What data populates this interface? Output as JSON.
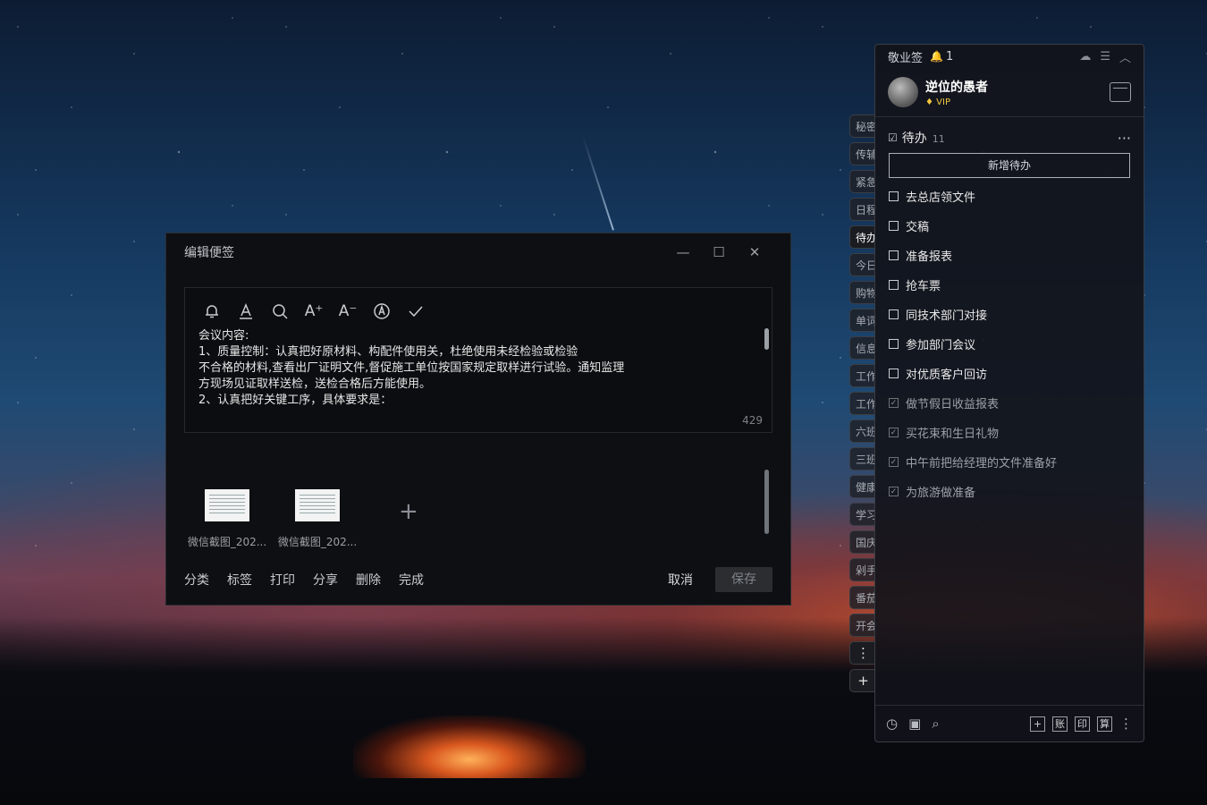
{
  "editor": {
    "title": "编辑便签",
    "win_min": "—",
    "win_max": "☐",
    "win_close": "✕",
    "toolbar": {
      "font_up": "A⁺",
      "font_down": "A⁻"
    },
    "content_lines": [
      "会议内容:",
      "1、质量控制：认真把好原材料、构配件使用关，杜绝使用未经检验或检验",
      "不合格的材料,查看出厂证明文件,督促施工单位按国家规定取样进行试验。通知监理",
      "方现场见证取样送检，送检合格后方能使用。",
      "2、认真把好关键工序，具体要求是："
    ],
    "char_count": "429",
    "attachments": [
      {
        "name": "微信截图_202..."
      },
      {
        "name": "微信截图_202..."
      }
    ],
    "add_attachment": "+",
    "actions": {
      "category": "分类",
      "tag": "标签",
      "print": "打印",
      "share": "分享",
      "delete": "删除",
      "done": "完成"
    },
    "cancel": "取消",
    "save": "保存"
  },
  "side_tabs": [
    {
      "label": "秘密"
    },
    {
      "label": "传辅"
    },
    {
      "label": "紧急"
    },
    {
      "label": "日程"
    },
    {
      "label": "待办"
    },
    {
      "label": "今日"
    },
    {
      "label": "购物"
    },
    {
      "label": "单词"
    },
    {
      "label": "信息"
    },
    {
      "label": "工作"
    },
    {
      "label": "工作"
    },
    {
      "label": "六班"
    },
    {
      "label": "三班"
    },
    {
      "label": "健康"
    },
    {
      "label": "学习"
    },
    {
      "label": "国庆"
    },
    {
      "label": "剁手"
    },
    {
      "label": "番茄"
    },
    {
      "label": "开会"
    }
  ],
  "side_more": "⋮",
  "side_add": "+",
  "panel": {
    "app_name": "敬业签",
    "reminder_count": "1",
    "user": {
      "name": "逆位的愚者",
      "badge": "VIP"
    },
    "list": {
      "title": "待办",
      "count": "11",
      "add_label": "新增待办"
    },
    "todos": [
      {
        "text": "去总店领文件",
        "done": false
      },
      {
        "text": "交稿",
        "done": false
      },
      {
        "text": "准备报表",
        "done": false
      },
      {
        "text": "抢车票",
        "done": false
      },
      {
        "text": "同技术部门对接",
        "done": false
      },
      {
        "text": "参加部门会议",
        "done": false
      },
      {
        "text": "对优质客户回访",
        "done": false
      },
      {
        "text": "做节假日收益报表",
        "done": true
      },
      {
        "text": "买花束和生日礼物",
        "done": true
      },
      {
        "text": "中午前把给经理的文件准备好",
        "done": true
      },
      {
        "text": "为旅游做准备",
        "done": true
      }
    ],
    "bottom": {
      "ledger": "账",
      "print": "印",
      "calc": "算",
      "add": "+"
    }
  }
}
